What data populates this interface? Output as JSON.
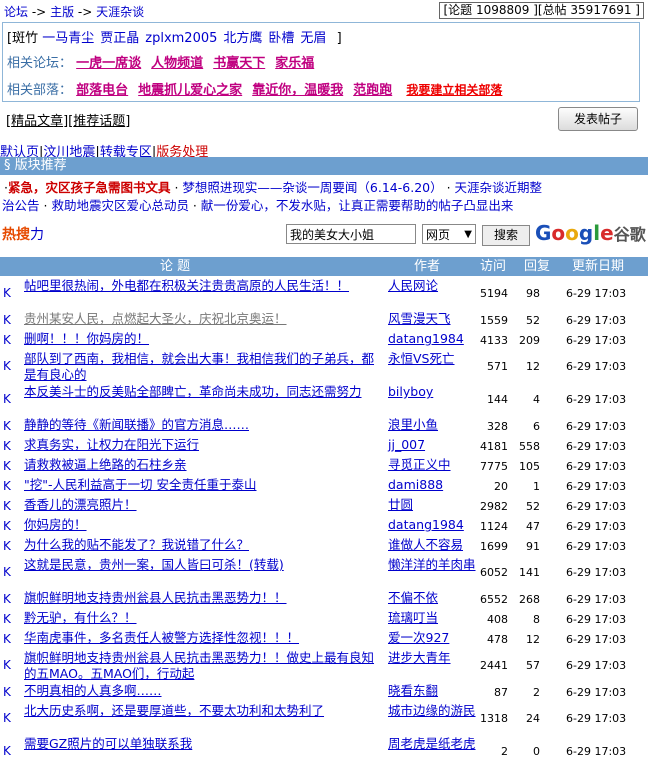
{
  "breadcrumb": {
    "items": [
      "论坛",
      "主版",
      "天涯杂谈"
    ],
    "sep": "->"
  },
  "stats": {
    "text": "[论题 1098809 ][总帖 35917691 ]"
  },
  "info": {
    "row1_label": "[斑竹",
    "row1_names": [
      "一马青尘",
      "贾正晶",
      "zplxm2005",
      "北方鹰",
      "卧槽",
      "无眉"
    ],
    "row1_end": "]",
    "row2_label": "相关论坛：",
    "row2_links": [
      "一虎一席谈",
      "人物频道",
      "书赢天下",
      "家乐福"
    ],
    "row3_label": "相关部落：",
    "row3_links": [
      "部落电台",
      "地震抓儿爱心之家",
      "靠近你，温暖我",
      "范跑跑"
    ],
    "row3_red": "我要建立相关部落"
  },
  "links": {
    "featured": "精品文章",
    "recommended": "推荐话题",
    "post_button": "发表帖子"
  },
  "tabs": [
    {
      "label": "默认页"
    },
    {
      "label": "汶川地震"
    },
    {
      "label": "转载专区"
    },
    {
      "label": "版务处理",
      "active": true
    }
  ],
  "section": {
    "title": "§ 版块推荐"
  },
  "recs": {
    "line1_red": "紧急，灾区孩子急需图书文具",
    "line1_blue1": "梦想照进现实——杂谈一周要闻（6.14-6.20）",
    "line1_blue2": "天涯杂谈近期整",
    "line2": "治公告",
    "line2_b": "救助地震灾区爱心总动员",
    "line2_c": "献一份爱心，不发水贴，让真正需要帮助的帖子凸显出来"
  },
  "search": {
    "hot_label1": "热",
    "hot_label2": "搜",
    "power": "力",
    "query": "我的美女大小姐",
    "type": "网页",
    "button": "搜索",
    "logo_cn": "谷歌"
  },
  "table": {
    "headers": {
      "topic": "论    题",
      "author": "作者",
      "views": "访问",
      "replies": "回复",
      "updated": "更新日期"
    },
    "rows": [
      {
        "k": "K",
        "title": "帖吧里很热闹，外电都在积极关注贵贵高原的人民生活！！",
        "author": "人民网论",
        "views": "5194",
        "replies": "98",
        "date": "6-29 17:03",
        "lines": 2
      },
      {
        "k": "K",
        "title": "贵州某安人民，点燃起大圣火，庆祝北京奥运！",
        "author": "风雪漫天飞",
        "views": "1559",
        "replies": "52",
        "date": "6-29 17:03",
        "lines": 1,
        "gray": true
      },
      {
        "k": "K",
        "title": "删啊！！！你妈房的！",
        "author": "datang1984",
        "views": "4133",
        "replies": "209",
        "date": "6-29 17:03",
        "lines": 1
      },
      {
        "k": "K",
        "title": "部队到了西南，我相信，就会出大事！我相信我们的子弟兵，都是有良心的",
        "author": "永恒VS死亡",
        "views": "571",
        "replies": "12",
        "date": "6-29 17:03",
        "lines": 2
      },
      {
        "k": "K",
        "title": "本反美斗士的反美贴全部睥亡，革命尚未成功，同志还需努力",
        "author": "bilyboy",
        "views": "144",
        "replies": "4",
        "date": "6-29 17:03",
        "lines": 2
      },
      {
        "k": "K",
        "title": "静静的等待《新闻联播》的官方消息……",
        "author": "浪里小鱼",
        "views": "328",
        "replies": "6",
        "date": "6-29 17:03",
        "lines": 1
      },
      {
        "k": "K",
        "title": "求真务实，让权力在阳光下运行",
        "author": "jj_007",
        "views": "4181",
        "replies": "558",
        "date": "6-29 17:03",
        "lines": 1
      },
      {
        "k": "K",
        "title": "请救救被逼上绝路的石柱乡亲",
        "author": "寻觅正义中",
        "views": "7775",
        "replies": "105",
        "date": "6-29 17:03",
        "lines": 1
      },
      {
        "k": "K",
        "title": "\"挖\"-人民利益高于一切 安全责任重于泰山",
        "author": "dami888",
        "views": "20",
        "replies": "1",
        "date": "6-29 17:03",
        "lines": 1
      },
      {
        "k": "K",
        "title": "香香儿的漂亮照片！",
        "author": "廿圆",
        "views": "2982",
        "replies": "52",
        "date": "6-29 17:03",
        "lines": 1
      },
      {
        "k": "K",
        "title": "你妈房的！",
        "author": "datang1984",
        "views": "1124",
        "replies": "47",
        "date": "6-29 17:03",
        "lines": 1
      },
      {
        "k": "K",
        "title": "为什么我的贴不能发了？我说错了什么？",
        "author": "谁做人不容易",
        "views": "1699",
        "replies": "91",
        "date": "6-29 17:03",
        "lines": 1
      },
      {
        "k": "K",
        "title": "这就是民意，贵州一案，国人皆曰可杀！(转载)",
        "author": "懒洋洋的羊肉串",
        "views": "6052",
        "replies": "141",
        "date": "6-29 17:03",
        "lines": 2
      },
      {
        "k": "K",
        "title": "旗帜鲜明地支持贵州瓮县人民抗击黑恶势力！！",
        "author": "不偏不依",
        "views": "6552",
        "replies": "268",
        "date": "6-29 17:03",
        "lines": 1
      },
      {
        "k": "K",
        "title": "黔无驴，有什么？！",
        "author": "琉璃叮当",
        "views": "408",
        "replies": "8",
        "date": "6-29 17:03",
        "lines": 1
      },
      {
        "k": "K",
        "title": "华南虎事件，多名责任人被警方选择性忽视！！！",
        "author": "爱一次927",
        "views": "478",
        "replies": "12",
        "date": "6-29 17:03",
        "lines": 1
      },
      {
        "k": "K",
        "title": "旗帜鲜明地支持贵州瓮县人民抗击黑恶势力！！做史上最有良知的五MAO。五MAO们，行动起",
        "author": "进步大青年",
        "views": "2441",
        "replies": "57",
        "date": "6-29 17:03",
        "lines": 2
      },
      {
        "k": "K",
        "title": "不明真相的人真多啊……",
        "author": "晓看东翻",
        "views": "87",
        "replies": "2",
        "date": "6-29 17:03",
        "lines": 1
      },
      {
        "k": "K",
        "title": "北大历史系啊，还是要厚道些，不要太功利和太势利了",
        "author": "城市边缘的游民",
        "views": "1318",
        "replies": "24",
        "date": "6-29 17:03",
        "lines": 2
      },
      {
        "k": "K",
        "title": "需要GZ照片的可以单独联系我",
        "author": "周老虎是纸老虎",
        "views": "2",
        "replies": "0",
        "date": "6-29 17:03",
        "lines": 2
      }
    ]
  }
}
